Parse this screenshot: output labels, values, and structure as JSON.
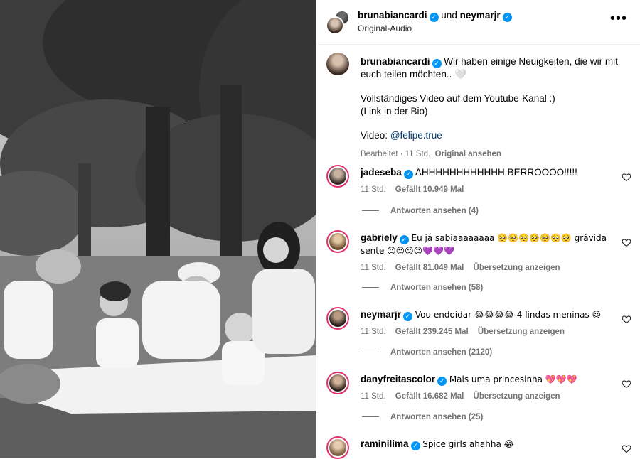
{
  "header": {
    "user1": "brunabiancardi",
    "joiner": "und",
    "user2": "neymarjr",
    "audio": "Original-Audio"
  },
  "caption": {
    "username": "brunabiancardi",
    "line1": "Wir haben einige Neuigkeiten, die wir mit euch teilen möchten.. 🤍",
    "line2": "Vollständiges Video auf dem Youtube-Kanal :)",
    "line3": "(Link in der Bio)",
    "video_label": "Video:",
    "video_handle": "@felipe.true",
    "edited": "Bearbeitet · 11 Std.",
    "original": "Original ansehen"
  },
  "comments": [
    {
      "username": "jadeseba",
      "text": "AHHHHHHHHHHHH BERROOOO!!!!!",
      "time": "11 Std.",
      "likes": "Gefällt 10.949 Mal",
      "translate": "",
      "replies": "Antworten ansehen (4)"
    },
    {
      "username": "gabriely",
      "text": "Eu já sabiaaaaaaaa 🥺🥺🥺🥺🥺🥺🥺 grávida sente 😍😍😍😍💜💜💜",
      "time": "11 Std.",
      "likes": "Gefällt 81.049 Mal",
      "translate": "Übersetzung anzeigen",
      "replies": "Antworten ansehen (58)"
    },
    {
      "username": "neymarjr",
      "text": "Vou endoidar 😂😂😂😂 4 lindas meninas 😍",
      "time": "11 Std.",
      "likes": "Gefällt 239.245 Mal",
      "translate": "Übersetzung anzeigen",
      "replies": "Antworten ansehen (2120)"
    },
    {
      "username": "danyfreitascolor",
      "text": "Mais uma princesinha 💖💖💖",
      "time": "11 Std.",
      "likes": "Gefällt 16.682 Mal",
      "translate": "Übersetzung anzeigen",
      "replies": "Antworten ansehen (25)"
    },
    {
      "username": "raminilima",
      "text": "Spice girls ahahha 😂",
      "time": "",
      "likes": "",
      "translate": "",
      "replies": ""
    }
  ],
  "icons": {
    "verified": "verified-badge-icon",
    "more": "more-options-icon",
    "heart": "heart-icon"
  },
  "colors": {
    "verified": "#0095f6",
    "link": "#00376b",
    "muted": "#737373",
    "story_ring": "#e1306c"
  }
}
